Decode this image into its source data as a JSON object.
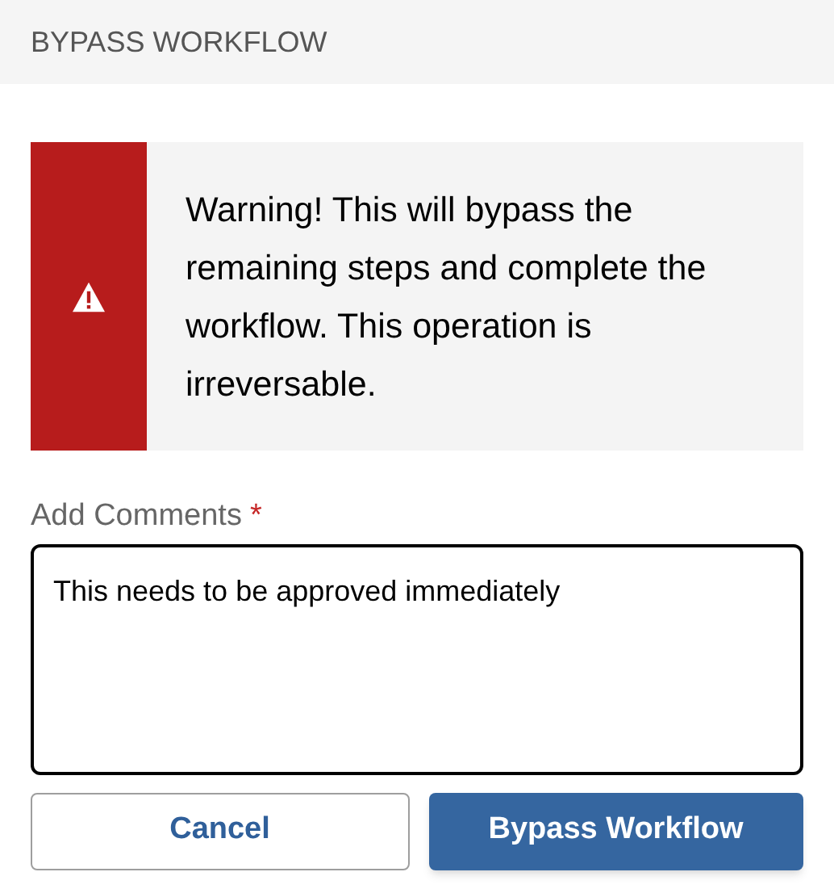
{
  "header": {
    "title": "BYPASS WORKFLOW"
  },
  "warning": {
    "message": "Warning! This will bypass the remaining steps and complete the workflow. This operation is irreversable."
  },
  "comments": {
    "label": "Add Comments",
    "required_mark": "*",
    "value": "This needs to be approved immediately"
  },
  "buttons": [
    {
      "label": "Cancel",
      "kind": "secondary"
    },
    {
      "label": "Bypass Workflow",
      "kind": "primary"
    }
  ]
}
